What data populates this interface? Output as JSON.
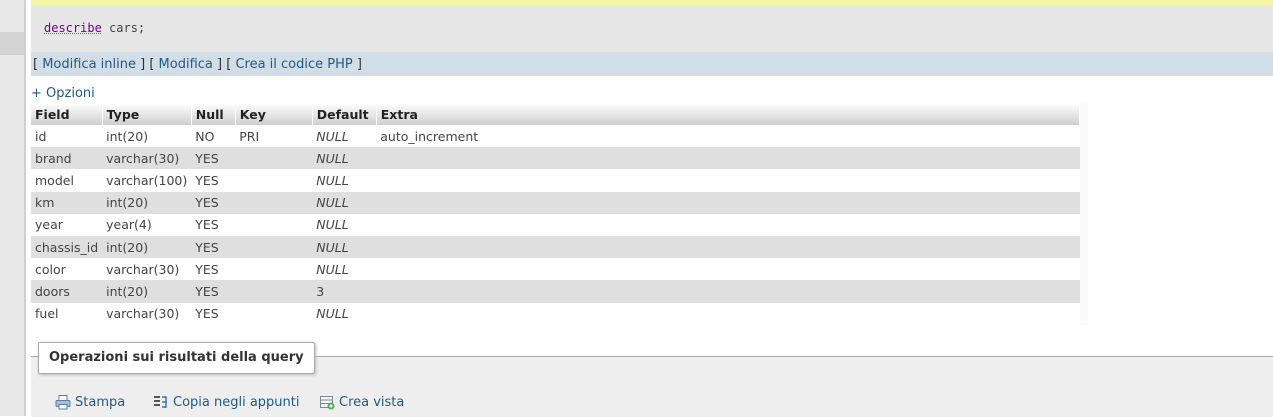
{
  "sql": {
    "keyword": "describe",
    "rest": " cars;"
  },
  "links": {
    "open1": "[ ",
    "edit_inline": "Modifica inline",
    "sep1": " ] [ ",
    "edit": "Modifica",
    "sep2": " ] [ ",
    "php": "Crea il codice PHP",
    "close": " ]"
  },
  "options_label": "+ Opzioni",
  "table": {
    "headers": [
      "Field",
      "Type",
      "Null",
      "Key",
      "Default",
      "Extra"
    ],
    "rows": [
      [
        "id",
        "int(20)",
        "NO",
        "PRI",
        "NULL",
        "auto_increment"
      ],
      [
        "brand",
        "varchar(30)",
        "YES",
        "",
        "NULL",
        ""
      ],
      [
        "model",
        "varchar(100)",
        "YES",
        "",
        "NULL",
        ""
      ],
      [
        "km",
        "int(20)",
        "YES",
        "",
        "NULL",
        ""
      ],
      [
        "year",
        "year(4)",
        "YES",
        "",
        "NULL",
        ""
      ],
      [
        "chassis_id",
        "int(20)",
        "YES",
        "",
        "NULL",
        ""
      ],
      [
        "color",
        "varchar(30)",
        "YES",
        "",
        "NULL",
        ""
      ],
      [
        "doors",
        "int(20)",
        "YES",
        "",
        "3",
        ""
      ],
      [
        "fuel",
        "varchar(30)",
        "YES",
        "",
        "NULL",
        ""
      ]
    ]
  },
  "operations": {
    "title": "Operazioni sui risultati della query",
    "print": "Stampa",
    "copy": "Copia negli appunti",
    "create_view": "Crea vista"
  },
  "colors": {
    "link": "#235a81",
    "row_alt": "#dfdfdf",
    "links_bar": "#d1dee8"
  }
}
